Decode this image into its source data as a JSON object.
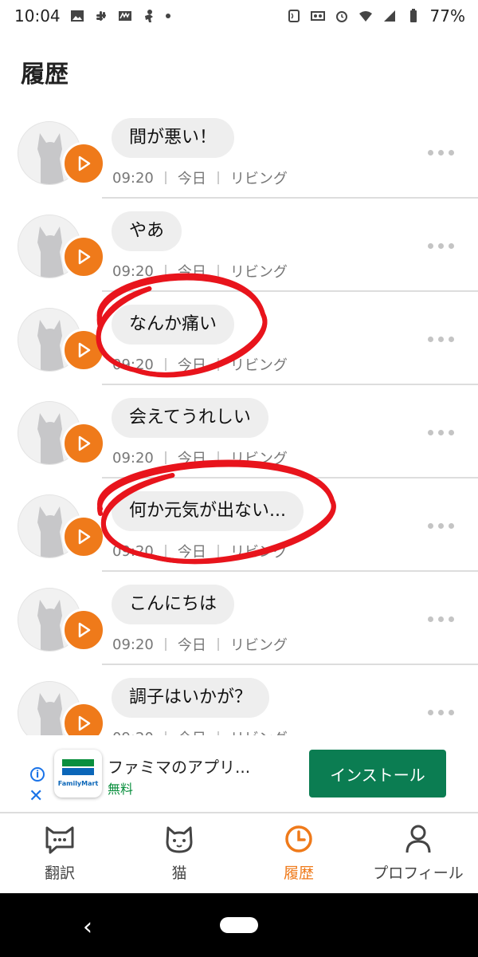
{
  "status": {
    "time": "10:04",
    "battery": "77%"
  },
  "page_title": "履歴",
  "history": [
    {
      "text": "間が悪い！",
      "time": "09:20",
      "day": "今日",
      "room": "リビング",
      "circled": false
    },
    {
      "text": "やあ",
      "time": "09:20",
      "day": "今日",
      "room": "リビング",
      "circled": false
    },
    {
      "text": "なんか痛い",
      "time": "09:20",
      "day": "今日",
      "room": "リビング",
      "circled": true
    },
    {
      "text": "会えてうれしい",
      "time": "09:20",
      "day": "今日",
      "room": "リビング",
      "circled": false
    },
    {
      "text": "何か元気が出ない...",
      "time": "09:20",
      "day": "今日",
      "room": "リビング",
      "circled": true
    },
    {
      "text": "こんにちは",
      "time": "09:20",
      "day": "今日",
      "room": "リビング",
      "circled": false
    },
    {
      "text": "調子はいかが？",
      "time": "09:20",
      "day": "今日",
      "room": "リビング",
      "circled": false
    }
  ],
  "ad": {
    "title": "ファミマのアプリ...",
    "subtitle": "無料",
    "logo_text": "FamilyMart",
    "install_label": "インストール"
  },
  "nav": {
    "items": [
      {
        "label": "翻訳",
        "icon": "chat-cat-icon",
        "active": false
      },
      {
        "label": "猫",
        "icon": "cat-face-icon",
        "active": false
      },
      {
        "label": "履歴",
        "icon": "clock-icon",
        "active": true
      },
      {
        "label": "プロフィール",
        "icon": "person-icon",
        "active": false
      }
    ]
  },
  "colors": {
    "accent": "#ef7a1a",
    "annotation": "#e8141c",
    "install_button": "#0b7d52"
  }
}
